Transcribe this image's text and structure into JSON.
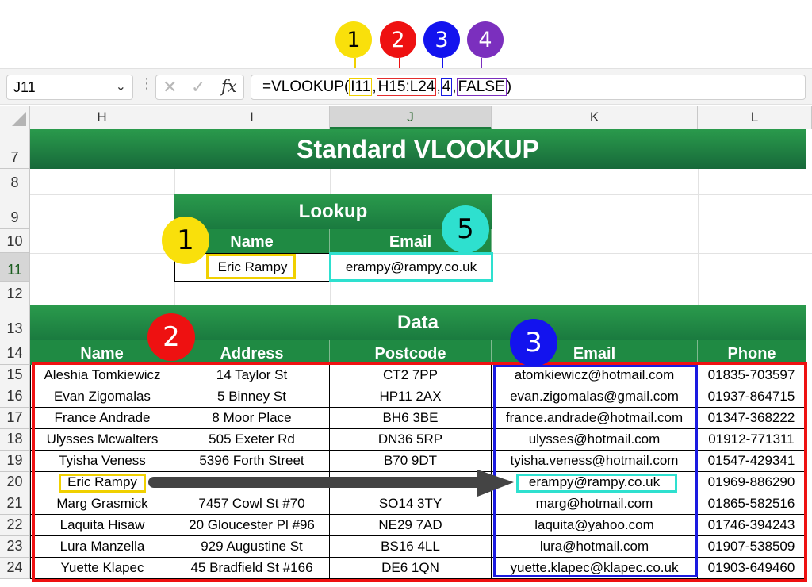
{
  "callouts": [
    {
      "num": "1",
      "color": "#f9e00b"
    },
    {
      "num": "2",
      "color": "#ee1111"
    },
    {
      "num": "3",
      "color": "#1313ee"
    },
    {
      "num": "4",
      "color": "#7b2fbe"
    },
    {
      "num": "5",
      "color": "#2ee0cf"
    }
  ],
  "formula_bar": {
    "name_box": "J11",
    "formula_parts": [
      "=VLOOKUP(",
      "I11",
      ",",
      "H15:L24",
      ",",
      "4",
      ",",
      "FALSE",
      ")"
    ]
  },
  "columns": [
    "H",
    "I",
    "J",
    "K",
    "L"
  ],
  "active_column": "J",
  "rows": [
    "7",
    "8",
    "9",
    "10",
    "11",
    "12",
    "13",
    "14",
    "15",
    "16",
    "17",
    "18",
    "19",
    "20",
    "21",
    "22",
    "23",
    "24"
  ],
  "active_row": "11",
  "title": "Standard VLOOKUP",
  "lookup": {
    "heading": "Lookup",
    "name_label": "Name",
    "email_label": "Email",
    "name_value": "Eric Rampy",
    "email_value": "erampy@rampy.co.uk"
  },
  "data_table": {
    "heading": "Data",
    "headers": [
      "Name",
      "Address",
      "Postcode",
      "Email",
      "Phone"
    ],
    "rows": [
      [
        "Aleshia Tomkiewicz",
        "14 Taylor St",
        "CT2 7PP",
        "atomkiewicz@hotmail.com",
        "01835-703597"
      ],
      [
        "Evan Zigomalas",
        "5 Binney St",
        "HP11 2AX",
        "evan.zigomalas@gmail.com",
        "01937-864715"
      ],
      [
        "France Andrade",
        "8 Moor Place",
        "BH6 3BE",
        "france.andrade@hotmail.com",
        "01347-368222"
      ],
      [
        "Ulysses Mcwalters",
        "505 Exeter Rd",
        "DN36 5RP",
        "ulysses@hotmail.com",
        "01912-771311"
      ],
      [
        "Tyisha Veness",
        "5396 Forth Street",
        "B70 9DT",
        "tyisha.veness@hotmail.com",
        "01547-429341"
      ],
      [
        "Eric Rampy",
        "",
        "",
        "erampy@rampy.co.uk",
        "01969-886290"
      ],
      [
        "Marg Grasmick",
        "7457 Cowl St #70",
        "SO14 3TY",
        "marg@hotmail.com",
        "01865-582516"
      ],
      [
        "Laquita Hisaw",
        "20 Gloucester Pl #96",
        "NE29 7AD",
        "laquita@yahoo.com",
        "01746-394243"
      ],
      [
        "Lura Manzella",
        "929 Augustine St",
        "BS16 4LL",
        "lura@hotmail.com",
        "01907-538509"
      ],
      [
        "Yuette Klapec",
        "45 Bradfield St #166",
        "DE6 1QN",
        "yuette.klapec@klapec.co.uk",
        "01903-649460"
      ]
    ]
  },
  "colors": {
    "header_green": "#1f8a43",
    "highlight_yellow": "#f0d000",
    "highlight_red": "#ee1111",
    "highlight_blue": "#1a1ae0",
    "highlight_teal": "#2ee0cf",
    "arrow": "#444444"
  }
}
